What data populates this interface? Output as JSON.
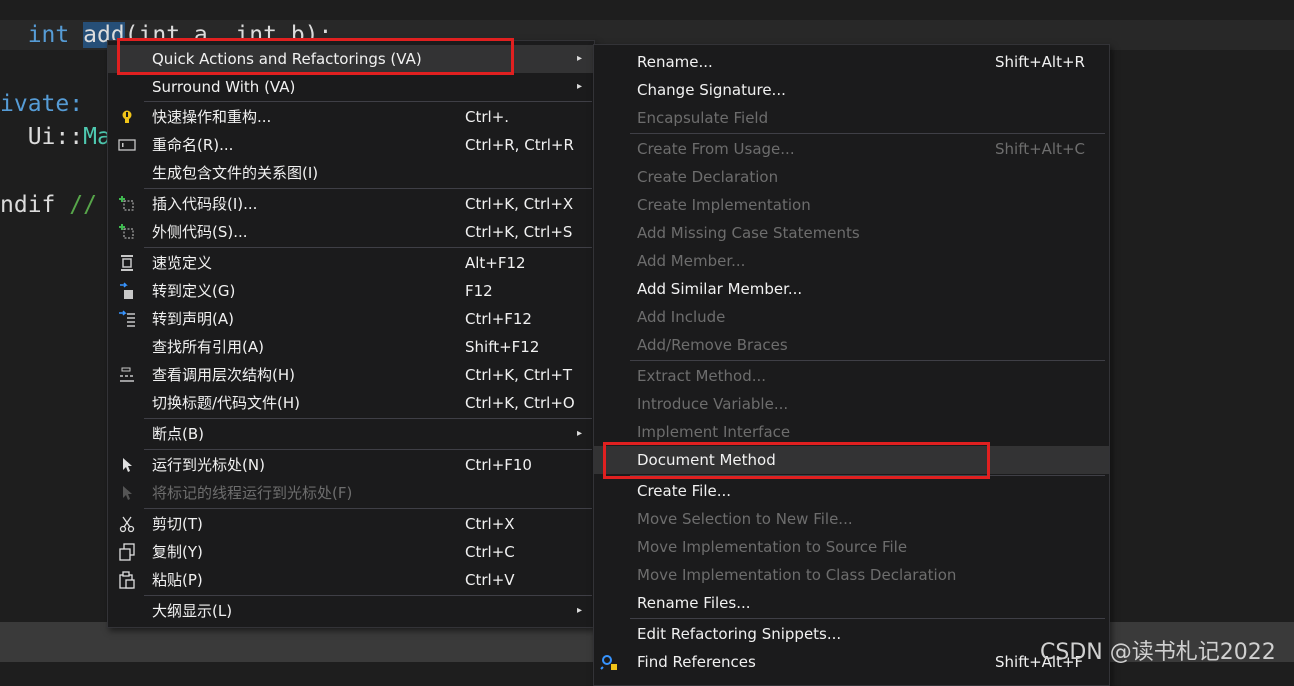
{
  "code": {
    "line1_kw": "int",
    "line1_selected": "add",
    "line1_rest": "(int a, int b);",
    "line2": "ivate:",
    "line3_prefix": "  Ui::",
    "line3_ns": "Ma",
    "line4_prefix": "ndif",
    "line4_comment": " //"
  },
  "main_menu": {
    "items": [
      {
        "label": "Quick Actions and Refactorings (VA)",
        "shortcut": "",
        "has_submenu": true
      },
      {
        "label": "Surround With (VA)",
        "shortcut": "",
        "has_submenu": true
      },
      {
        "label": "快速操作和重构...",
        "shortcut": "Ctrl+.",
        "icon": "lightbulb-icon"
      },
      {
        "label": "重命名(R)...",
        "shortcut": "Ctrl+R, Ctrl+R",
        "icon": "rename-icon"
      },
      {
        "label": "生成包含文件的关系图(I)",
        "shortcut": ""
      },
      {
        "label": "插入代码段(I)...",
        "shortcut": "Ctrl+K, Ctrl+X",
        "icon": "insert-snippet-icon"
      },
      {
        "label": "外侧代码(S)...",
        "shortcut": "Ctrl+K, Ctrl+S",
        "icon": "surround-snippet-icon"
      },
      {
        "label": "速览定义",
        "shortcut": "Alt+F12",
        "icon": "peek-definition-icon"
      },
      {
        "label": "转到定义(G)",
        "shortcut": "F12",
        "icon": "goto-definition-icon"
      },
      {
        "label": "转到声明(A)",
        "shortcut": "Ctrl+F12",
        "icon": "goto-declaration-icon"
      },
      {
        "label": "查找所有引用(A)",
        "shortcut": "Shift+F12"
      },
      {
        "label": "查看调用层次结构(H)",
        "shortcut": "Ctrl+K, Ctrl+T",
        "icon": "call-hierarchy-icon"
      },
      {
        "label": "切换标题/代码文件(H)",
        "shortcut": "Ctrl+K, Ctrl+O"
      },
      {
        "label": "断点(B)",
        "shortcut": "",
        "has_submenu": true
      },
      {
        "label": "运行到光标处(N)",
        "shortcut": "Ctrl+F10",
        "icon": "run-to-cursor-icon"
      },
      {
        "label": "将标记的线程运行到光标处(F)",
        "shortcut": "",
        "disabled": true,
        "icon": "run-flagged-threads-icon"
      },
      {
        "label": "剪切(T)",
        "shortcut": "Ctrl+X",
        "icon": "cut-icon"
      },
      {
        "label": "复制(Y)",
        "shortcut": "Ctrl+C",
        "icon": "copy-icon"
      },
      {
        "label": "粘贴(P)",
        "shortcut": "Ctrl+V",
        "icon": "paste-icon"
      },
      {
        "label": "大纲显示(L)",
        "shortcut": "",
        "has_submenu": true
      }
    ]
  },
  "sub_menu": {
    "items": [
      {
        "label": "Rename...",
        "shortcut": "Shift+Alt+R"
      },
      {
        "label": "Change Signature...",
        "shortcut": ""
      },
      {
        "label": "Encapsulate Field",
        "shortcut": "",
        "disabled": true
      },
      {
        "label": "Create From Usage...",
        "shortcut": "Shift+Alt+C",
        "disabled": true
      },
      {
        "label": "Create Declaration",
        "shortcut": "",
        "disabled": true
      },
      {
        "label": "Create Implementation",
        "shortcut": "",
        "disabled": true
      },
      {
        "label": "Add Missing Case Statements",
        "shortcut": "",
        "disabled": true
      },
      {
        "label": "Add Member...",
        "shortcut": "",
        "disabled": true
      },
      {
        "label": "Add Similar Member...",
        "shortcut": ""
      },
      {
        "label": "Add Include",
        "shortcut": "",
        "disabled": true
      },
      {
        "label": "Add/Remove Braces",
        "shortcut": "",
        "disabled": true
      },
      {
        "label": "Extract Method...",
        "shortcut": "",
        "disabled": true
      },
      {
        "label": "Introduce Variable...",
        "shortcut": "",
        "disabled": true
      },
      {
        "label": "Implement Interface",
        "shortcut": "",
        "disabled": true
      },
      {
        "label": "Document Method",
        "shortcut": "",
        "highlighted": true
      },
      {
        "label": "Create File...",
        "shortcut": ""
      },
      {
        "label": "Move Selection to New File...",
        "shortcut": "",
        "disabled": true
      },
      {
        "label": "Move Implementation to Source File",
        "shortcut": "",
        "disabled": true
      },
      {
        "label": "Move Implementation to Class Declaration",
        "shortcut": "",
        "disabled": true
      },
      {
        "label": "Rename Files...",
        "shortcut": ""
      },
      {
        "label": "Edit Refactoring Snippets...",
        "shortcut": ""
      },
      {
        "label": "Find References",
        "shortcut": "Shift+Alt+F",
        "icon": "find-references-icon"
      }
    ]
  },
  "submenu_arrow": "▸",
  "watermark": "CSDN @读书札记2022",
  "colors": {
    "highlight_box": "#e02020",
    "menu_bg": "#1b1b1c",
    "disabled_text": "#6d6d6d"
  }
}
